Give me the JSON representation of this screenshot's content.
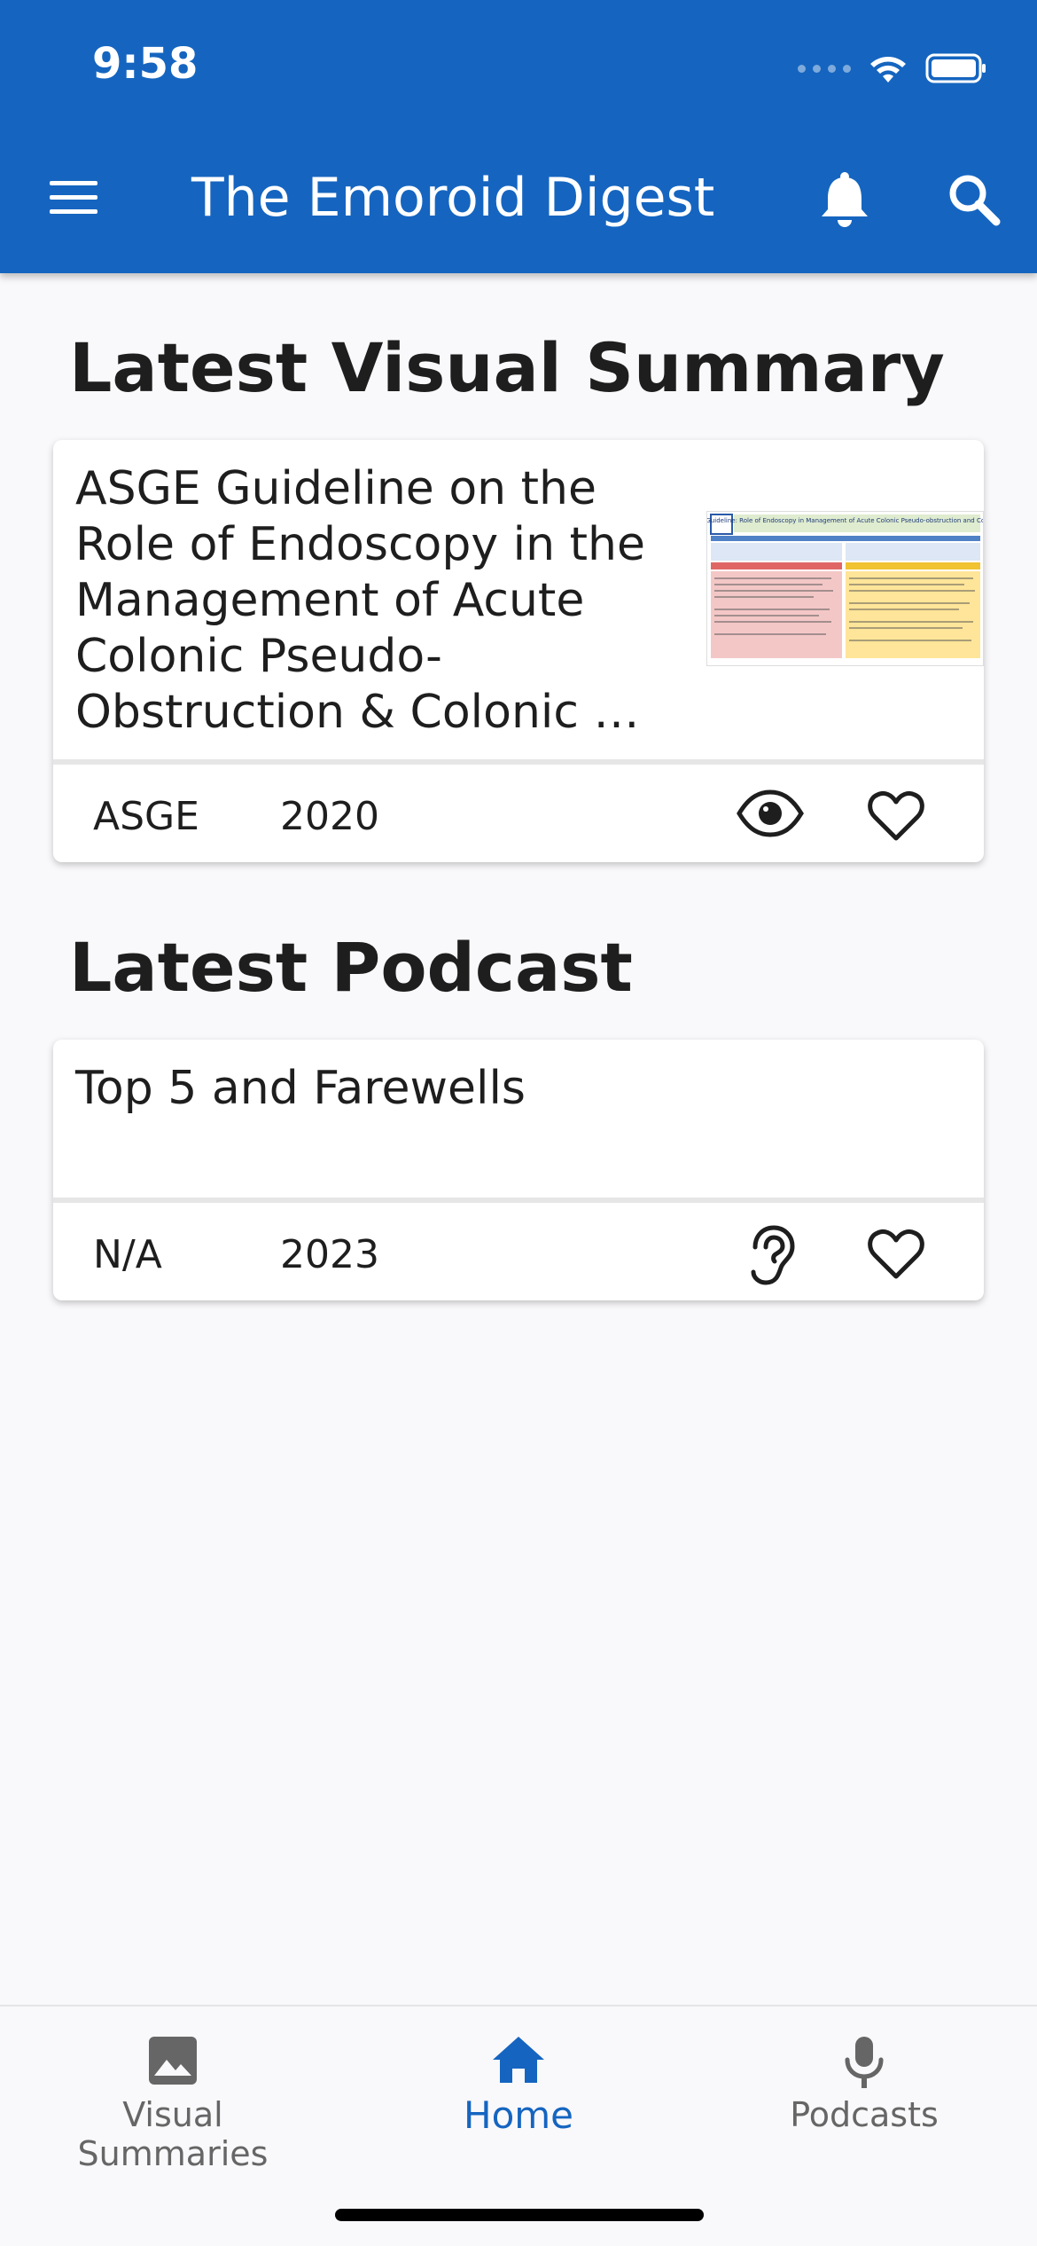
{
  "status_bar": {
    "time": "9:58"
  },
  "app_bar": {
    "title": "The Emoroid Digest"
  },
  "visual_summary_section": {
    "heading": "Latest Visual Summary",
    "card": {
      "title_lines": [
        "ASGE Guideline on the",
        "Role of Endoscopy in the",
        "Management of Acute",
        "Colonic Pseudo-",
        "Obstruction & Colonic …"
      ],
      "thumbnail_title": "ASGE Guideline: Role of Endoscopy in Management of Acute Colonic Pseudo-obstruction and Colonic Volvulus",
      "source": "ASGE",
      "year": "2020"
    }
  },
  "podcast_section": {
    "heading": "Latest Podcast",
    "card": {
      "title": "Top 5 and Farewells",
      "source": "N/A",
      "year": "2023"
    }
  },
  "bottom_nav": {
    "items": [
      {
        "label": "Visual Summaries",
        "icon": "image-icon",
        "active": false
      },
      {
        "label": "Home",
        "icon": "home-icon",
        "active": true
      },
      {
        "label": "Podcasts",
        "icon": "microphone-icon",
        "active": false
      }
    ]
  },
  "colors": {
    "primary": "#1565c0",
    "background": "#f9f8fa",
    "inactive": "#666666"
  }
}
